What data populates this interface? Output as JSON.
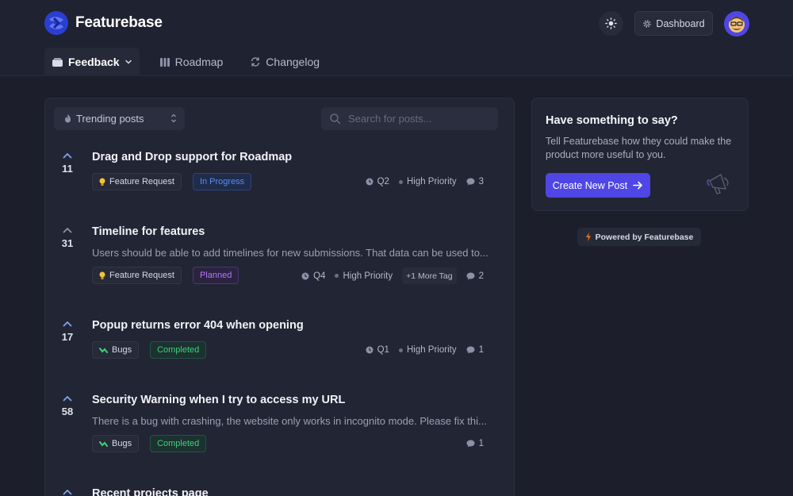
{
  "brand": {
    "name": "Featurebase"
  },
  "header": {
    "dashboard_label": "Dashboard"
  },
  "nav": {
    "tabs": [
      {
        "label": "Feedback"
      },
      {
        "label": "Roadmap"
      },
      {
        "label": "Changelog"
      }
    ]
  },
  "filters": {
    "sort_label": "Trending posts",
    "search_placeholder": "Search for posts..."
  },
  "posts": [
    {
      "votes": "11",
      "title": "Drag and Drop support for Roadmap",
      "description": "",
      "category": "Feature Request",
      "category_icon": "lightbulb-icon",
      "status": "In Progress",
      "eta": "Q2",
      "priority": "High Priority",
      "comments": "3"
    },
    {
      "votes": "31",
      "title": "Timeline for features",
      "description": "Users should be able to add timelines for new submissions. That data can be used to...",
      "category": "Feature Request",
      "category_icon": "lightbulb-icon",
      "status": "Planned",
      "eta": "Q4",
      "priority": "High Priority",
      "more_tags": "+1 More Tag",
      "comments": "2"
    },
    {
      "votes": "17",
      "title": "Popup returns error 404 when opening",
      "description": "",
      "category": "Bugs",
      "category_icon": "bug-icon",
      "status": "Completed",
      "eta": "Q1",
      "priority": "High Priority",
      "comments": "1"
    },
    {
      "votes": "58",
      "title": "Security Warning when I try to access my URL",
      "description": "There is a bug with crashing, the website only works in incognito mode. Please fix thi...",
      "category": "Bugs",
      "category_icon": "bug-icon",
      "status": "Completed",
      "comments": "1"
    },
    {
      "votes": "",
      "title": "Recent projects page"
    }
  ],
  "sidebar": {
    "cta_title": "Have something to say?",
    "cta_text": "Tell Featurebase how they could make the product more useful to you.",
    "cta_button": "Create New Post",
    "powered_by": "Powered by Featurebase"
  },
  "colors": {
    "accent": "#4f46e5",
    "status_in_progress": "#5b8def",
    "status_planned": "#b278f0",
    "status_completed": "#3fd07a"
  }
}
